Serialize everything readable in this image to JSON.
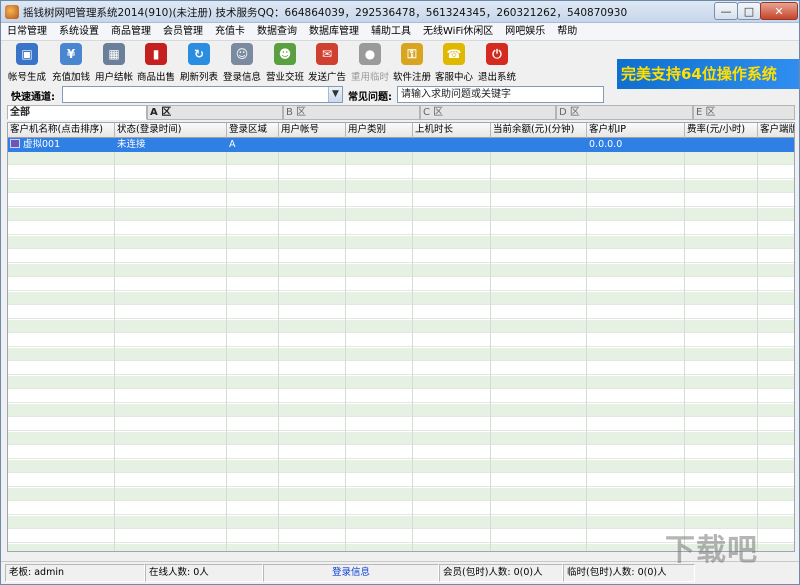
{
  "window": {
    "title": "摇钱树网吧管理系统2014(910)(未注册) 技术服务QQ：664864039，292536478，561324345，260321262，540870930",
    "min_glyph": "—",
    "max_glyph": "□",
    "close_glyph": "✕"
  },
  "menu": [
    "日常管理",
    "系统设置",
    "商品管理",
    "会员管理",
    "充值卡",
    "数据查询",
    "数据库管理",
    "辅助工具",
    "无线WiFi休闲区",
    "网吧娱乐",
    "帮助"
  ],
  "toolbar": [
    {
      "label": "帐号生成",
      "icon": "monitor-icon",
      "color": "#3a74c8",
      "glyph": "▣",
      "enabled": true
    },
    {
      "label": "充值加钱",
      "icon": "wallet-icon",
      "color": "#4a86d0",
      "glyph": "¥",
      "enabled": true
    },
    {
      "label": "用户结帐",
      "icon": "calculator-icon",
      "color": "#6a7f99",
      "glyph": "▦",
      "enabled": true
    },
    {
      "label": "商品出售",
      "icon": "cola-can-icon",
      "color": "#c42020",
      "glyph": "▮",
      "enabled": true
    },
    {
      "label": "刷新列表",
      "icon": "refresh-icon",
      "color": "#2a8de0",
      "glyph": "↻",
      "enabled": true
    },
    {
      "label": "登录信息",
      "icon": "users-icon",
      "color": "#7a8aa0",
      "glyph": "☺",
      "enabled": true
    },
    {
      "label": "营业交班",
      "icon": "handover-icon",
      "color": "#5aa040",
      "glyph": "☻",
      "enabled": true
    },
    {
      "label": "发送广告",
      "icon": "megaphone-icon",
      "color": "#d04030",
      "glyph": "✉",
      "enabled": true
    },
    {
      "label": "重用临时",
      "icon": "reuse-icon",
      "color": "#9a9a9a",
      "glyph": "●",
      "enabled": false
    },
    {
      "label": "软件注册",
      "icon": "key-icon",
      "color": "#d9a520",
      "glyph": "⚿",
      "enabled": true
    },
    {
      "label": "客服中心",
      "icon": "headset-icon",
      "color": "#e0b800",
      "glyph": "☎",
      "enabled": true
    },
    {
      "label": "退出系统",
      "icon": "power-icon",
      "color": "#d42a1f",
      "glyph": "⏻",
      "enabled": true
    }
  ],
  "banner": {
    "text": "完美支持64位操作系统"
  },
  "quick": {
    "channel_label": "快速通道:",
    "channel_value": "",
    "faq_label": "常见问题:",
    "faq_placeholder": "请输入求助问题或关键字"
  },
  "tabs": [
    "全部",
    "A 区",
    "B 区",
    "C 区",
    "D 区",
    "E 区"
  ],
  "grid": {
    "columns": [
      "客户机名称(点击排序)",
      "状态(登录时间)",
      "登录区域",
      "用户帐号",
      "用户类别",
      "上机时长",
      "当前余额(元)(分钟)",
      "客户机IP",
      "费率(元/小时)",
      "客户端版本"
    ],
    "rows": [
      {
        "name": "虚拟001",
        "status": "未连接",
        "area": "A",
        "account": "",
        "category": "",
        "duration": "",
        "balance": "",
        "ip": "0.0.0.0",
        "rate": "",
        "version": ""
      }
    ]
  },
  "status": {
    "boss": "老板: admin",
    "online": "在线人数: 0人",
    "login_info": "登录信息",
    "member": "会员(包时)人数: 0(0)人",
    "temp": "临时(包时)人数: 0(0)人"
  },
  "watermark": "下载吧"
}
